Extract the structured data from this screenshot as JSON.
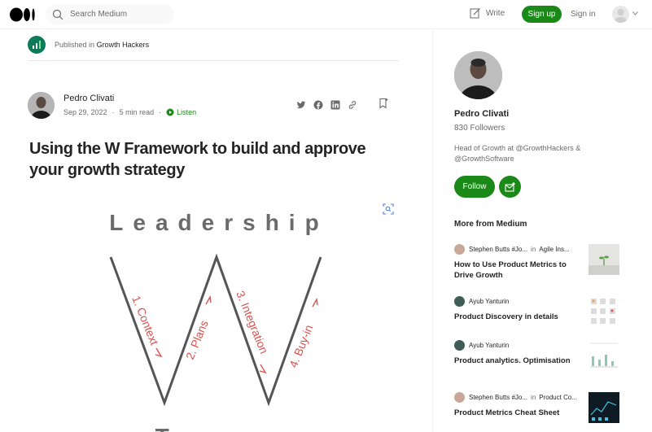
{
  "header": {
    "search_placeholder": "Search Medium",
    "write_label": "Write",
    "signup_label": "Sign up",
    "signin_label": "Sign in"
  },
  "article": {
    "published_prefix": "Published in",
    "publication": "Growth Hackers",
    "author": "Pedro Clivati",
    "date": "Sep 29, 2022",
    "read_time": "5 min read",
    "listen_label": "Listen",
    "title": "Using the W Framework to build and approve your growth strategy",
    "figure": {
      "top_label": "Leadership",
      "bottom_label": "Teams",
      "steps": [
        "1. Context",
        "2. Plans",
        "3. Integration",
        "4. Buy-in"
      ],
      "step_color": "#d9534f"
    }
  },
  "sidebar": {
    "author_name": "Pedro Clivati",
    "followers": "830 Followers",
    "bio": "Head of Growth at @GrowthHackers & @GrowthSoftware",
    "follow_label": "Follow",
    "more_title": "More from Medium",
    "stories": [
      {
        "author": "Stephen Butts #Jo...",
        "in_label": "in",
        "publication": "Agile Ins...",
        "title": "How to Use Product Metrics to Drive Growth"
      },
      {
        "author": "Ayub Yanturin",
        "in_label": "",
        "publication": "",
        "title": "Product Discovery in details"
      },
      {
        "author": "Ayub Yanturin",
        "in_label": "",
        "publication": "",
        "title": "Product analytics. Optimisation"
      },
      {
        "author": "Stephen Butts #Jo...",
        "in_label": "in",
        "publication": "Product Co...",
        "title": "Product Metrics Cheat Sheet"
      }
    ]
  },
  "colors": {
    "accent": "#1a8917",
    "text": "#242424",
    "muted": "#6b6b6b"
  }
}
